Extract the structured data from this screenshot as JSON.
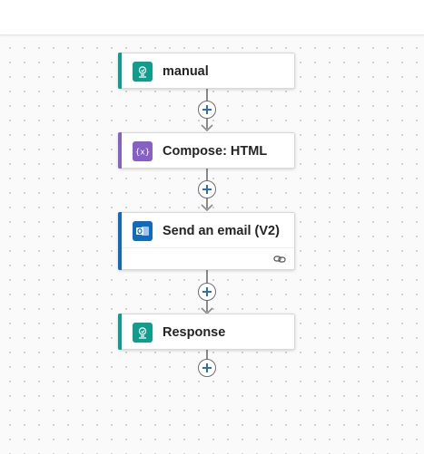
{
  "flow": {
    "steps": [
      {
        "title": "manual",
        "icon": "request-trigger-icon",
        "accent": "#0f9d8c"
      },
      {
        "title": "Compose: HTML",
        "icon": "compose-braces-icon",
        "accent": "#8661c5"
      },
      {
        "title": "Send an email (V2)",
        "icon": "outlook-icon",
        "accent": "#0f6cbd",
        "footer_icon": "link-icon"
      },
      {
        "title": "Response",
        "icon": "request-trigger-icon",
        "accent": "#0f9d8c"
      }
    ],
    "add_step_icon": "plus-circle-icon"
  }
}
